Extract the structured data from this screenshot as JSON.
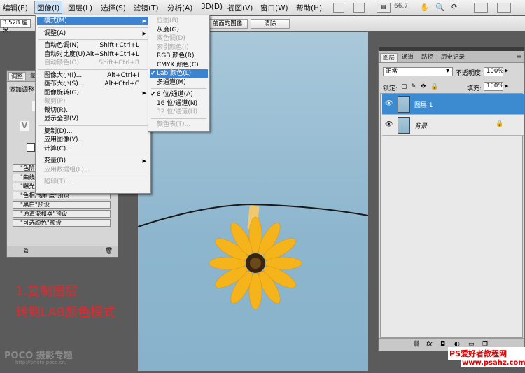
{
  "menubar": {
    "items": [
      "编辑(E)",
      "图像(I)",
      "图层(L)",
      "选择(S)",
      "滤镜(T)",
      "分析(A)",
      "3D(D)",
      "视图(V)",
      "窗口(W)",
      "帮助(H)"
    ],
    "zoom": "66.7"
  },
  "optionsbar": {
    "value": "3.528 厘米",
    "front_image_btn": "前面的图像",
    "clear_btn": "清除"
  },
  "image_menu": {
    "items": [
      {
        "label": "模式(M)",
        "sc": "",
        "sub": true,
        "state": "hl"
      },
      {
        "sep": true
      },
      {
        "label": "调整(A)",
        "sc": "",
        "sub": true
      },
      {
        "sep": true
      },
      {
        "label": "自动色调(N)",
        "sc": "Shift+Ctrl+L"
      },
      {
        "label": "自动对比度(U)",
        "sc": "Alt+Shift+Ctrl+L"
      },
      {
        "label": "自动颜色(O)",
        "sc": "Shift+Ctrl+B",
        "state": "dis"
      },
      {
        "sep": true
      },
      {
        "label": "图像大小(I)...",
        "sc": "Alt+Ctrl+I"
      },
      {
        "label": "画布大小(S)...",
        "sc": "Alt+Ctrl+C"
      },
      {
        "label": "图像旋转(G)",
        "sc": "",
        "sub": true
      },
      {
        "label": "裁剪(P)",
        "sc": "",
        "state": "dis"
      },
      {
        "label": "裁切(R)...",
        "sc": ""
      },
      {
        "label": "显示全部(V)",
        "sc": ""
      },
      {
        "sep": true
      },
      {
        "label": "复制(D)...",
        "sc": ""
      },
      {
        "label": "应用图像(Y)...",
        "sc": ""
      },
      {
        "label": "计算(C)...",
        "sc": ""
      },
      {
        "sep": true
      },
      {
        "label": "变量(B)",
        "sc": "",
        "sub": true
      },
      {
        "label": "应用数据组(L)...",
        "sc": "",
        "state": "dis"
      },
      {
        "sep": true
      },
      {
        "label": "陷印(T)...",
        "sc": "",
        "state": "dis"
      }
    ]
  },
  "mode_submenu": {
    "items": [
      {
        "label": "位图(B)",
        "state": "dis"
      },
      {
        "label": "灰度(G)"
      },
      {
        "label": "双色调(D)",
        "state": "dis"
      },
      {
        "label": "索引颜色(I)",
        "state": "dis"
      },
      {
        "label": "RGB 颜色(R)"
      },
      {
        "label": "CMYK 颜色(C)"
      },
      {
        "label": "Lab 颜色(L)",
        "state": "hl",
        "check": true
      },
      {
        "label": "多通道(M)"
      },
      {
        "sep": true
      },
      {
        "label": "8 位/通道(A)",
        "check": true
      },
      {
        "label": "16 位/通道(N)"
      },
      {
        "label": "32 位/通道(H)",
        "state": "dis"
      },
      {
        "sep": true
      },
      {
        "label": "颜色表(T)...",
        "state": "dis"
      }
    ]
  },
  "adjust_panel": {
    "tabs": [
      "调整",
      "蒙"
    ],
    "title": "添加调整",
    "presets": [
      "\"色阶\"预设",
      "\"曲线\"预设",
      "\"曝光度\"预设",
      "\"色相/饱和度\"预设",
      "\"黑白\"预设",
      "\"通道混和器\"预设",
      "\"可选颜色\"预设"
    ]
  },
  "layers_panel": {
    "tabs": [
      "图层",
      "通道",
      "路径",
      "历史记录"
    ],
    "blend": "正常",
    "opacity_label": "不透明度:",
    "opacity": "100%",
    "lock_label": "锁定:",
    "fill_label": "填充:",
    "fill": "100%",
    "layers": [
      {
        "name": "图层 1",
        "selected": true
      },
      {
        "name": "背景",
        "selected": false,
        "locked": true
      }
    ]
  },
  "annotation": {
    "line1": "1.复制图层",
    "line2": "转到LAB颜色模式"
  },
  "watermarks": {
    "left": "POCO 摄影专题",
    "left_url": "http://photo.poco.cn/",
    "right": "PS爱好者教程网",
    "right_url": "www.psahz.com"
  }
}
